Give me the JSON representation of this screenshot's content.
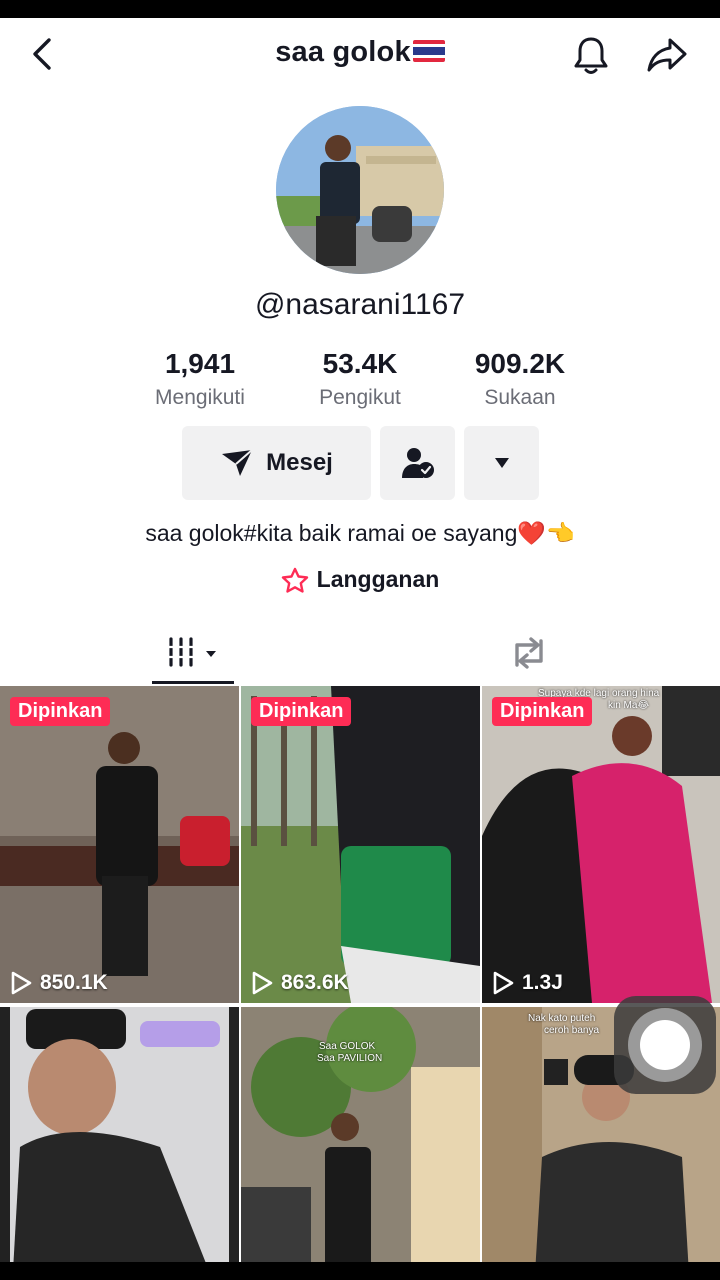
{
  "header": {
    "title": "saa golok",
    "back_icon": "chevron-left-icon",
    "bell_icon": "bell-icon",
    "share_icon": "share-icon"
  },
  "profile": {
    "handle": "@nasarani1167",
    "bio": "saa golok#kita baik ramai oe sayang❤️👈",
    "subscription_label": "Langganan"
  },
  "stats": [
    {
      "value": "1,941",
      "label": "Mengikuti"
    },
    {
      "value": "53.4K",
      "label": "Pengikut"
    },
    {
      "value": "909.2K",
      "label": "Sukaan"
    }
  ],
  "actions": {
    "message_label": "Mesej"
  },
  "tabs": {
    "videos_icon": "grid-icon",
    "repost_icon": "repost-icon"
  },
  "videos": [
    {
      "pinned_label": "Dipinkan",
      "views": "850.1K",
      "overlay": "",
      "overlay2": ""
    },
    {
      "pinned_label": "Dipinkan",
      "views": "863.6K",
      "overlay": "",
      "overlay2": ""
    },
    {
      "pinned_label": "Dipinkan",
      "views": "1.3J",
      "overlay": "Supaya kde lagi orang hina",
      "overlay2": "kin Ma😂"
    },
    {
      "pinned_label": "",
      "views": "",
      "overlay": "",
      "overlay2": ""
    },
    {
      "pinned_label": "",
      "views": "",
      "overlay": "Saa GOLOK",
      "overlay2": "Saa PAVILION"
    },
    {
      "pinned_label": "",
      "views": "",
      "overlay": "Nak kato puteh",
      "overlay2": "ceroh banya"
    }
  ],
  "colors": {
    "accent": "#fe2c55",
    "text": "#161823",
    "secondary": "#6b6d76",
    "button_bg": "#f1f1f2"
  }
}
